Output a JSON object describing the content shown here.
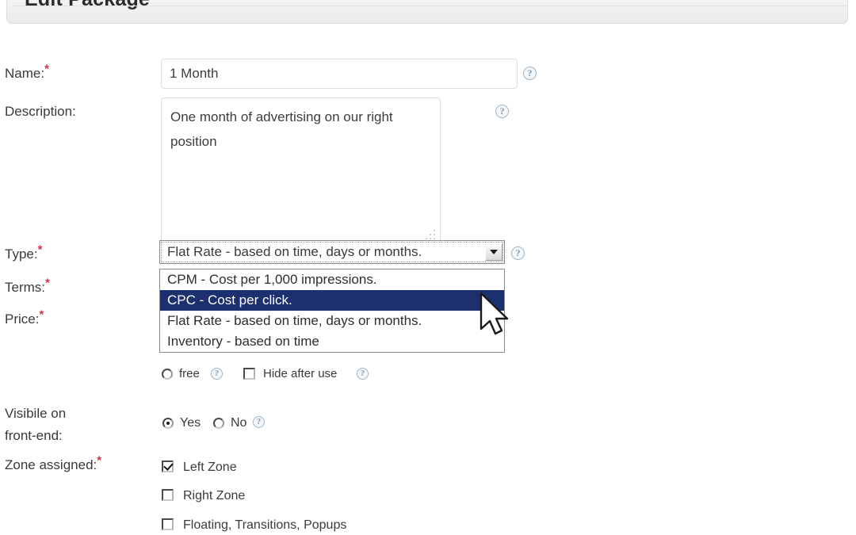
{
  "header": {
    "title": "Edit Package"
  },
  "form": {
    "name": {
      "label": "Name:",
      "required_marker": "*",
      "value": "1 Month",
      "placeholder": "",
      "help": "?"
    },
    "description": {
      "label": "Description:",
      "value": "One month of advertising on our right position",
      "placeholder": "",
      "help": "?"
    },
    "type": {
      "label": "Type:",
      "required_marker": "*",
      "selected": "Flat Rate - based on time, days or months.",
      "help": "?",
      "expanded": true,
      "highlighted_index": 1,
      "options": [
        "CPM - Cost per 1,000 impressions.",
        "CPC - Cost per click.",
        "Flat Rate - based on time, days or months.",
        "Inventory - based on time"
      ]
    },
    "terms": {
      "label": "Terms:",
      "required_marker": "*"
    },
    "price": {
      "label": "Price:",
      "required_marker": "*"
    },
    "free": {
      "label": "free",
      "checked": false,
      "help": "?"
    },
    "hide_after_use": {
      "label": "Hide after use",
      "checked": false,
      "help": "?"
    },
    "visible_front_end": {
      "label_line1": "Visibile on",
      "label_line2": "front-end:",
      "help": "?",
      "selected": "Yes",
      "options": [
        {
          "label": "Yes",
          "checked": true
        },
        {
          "label": "No",
          "checked": false
        }
      ]
    },
    "zone_assigned": {
      "label": "Zone assigned:",
      "required_marker": "*",
      "options": [
        {
          "label": "Left Zone",
          "checked": true
        },
        {
          "label": "Right Zone",
          "checked": false
        },
        {
          "label": "Floating, Transitions, Popups",
          "checked": false
        }
      ]
    }
  },
  "colors": {
    "required_asterisk": "#d6304a",
    "option_highlight": "#1c2f6e",
    "help_icon_border": "#9fb4c4",
    "input_border": "#dddddd",
    "select_border": "#8a8a8a",
    "text": "#3a3a3a"
  }
}
